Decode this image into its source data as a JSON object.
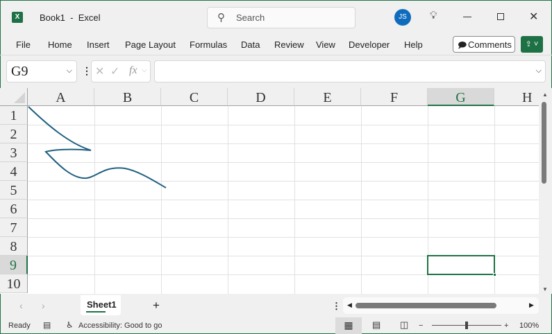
{
  "title": {
    "document": "Book1",
    "separator": "-",
    "app": "Excel",
    "search_placeholder": "Search",
    "avatar_initials": "JS"
  },
  "menu": [
    "File",
    "Home",
    "Insert",
    "Page Layout",
    "Formulas",
    "Data",
    "Review",
    "View",
    "Developer",
    "Help"
  ],
  "comments_label": "Comments",
  "formula_bar": {
    "name_box": "G9",
    "fx": "fx",
    "value": ""
  },
  "columns": [
    "A",
    "B",
    "C",
    "D",
    "E",
    "F",
    "G",
    "H"
  ],
  "rows": [
    "1",
    "2",
    "3",
    "4",
    "5",
    "6",
    "7",
    "8",
    "9",
    "10"
  ],
  "selected_cell": "G9",
  "sheets": [
    {
      "name": "Sheet1",
      "active": true
    }
  ],
  "status": {
    "ready": "Ready",
    "accessibility": "Accessibility: Good to go",
    "zoom": "100%"
  },
  "colors": {
    "accent": "#1e7145",
    "avatar": "#0f6cbd",
    "curve": "#1f5f7f"
  }
}
